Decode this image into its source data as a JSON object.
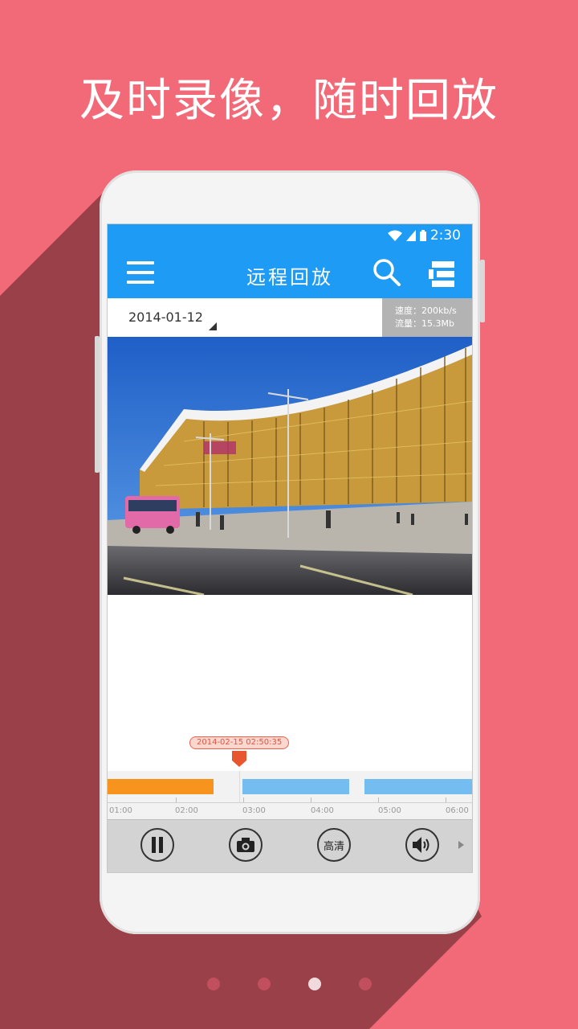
{
  "headline": "及时录像，随时回放",
  "status": {
    "time": "2:30"
  },
  "appbar": {
    "title": "远程回放"
  },
  "date_selector": {
    "value": "2014-01-12"
  },
  "stats": {
    "speed": "速度：200kb/s",
    "traffic": "流量：15.3Mb"
  },
  "timeline": {
    "current_time": "2014-02-15  02:50:35",
    "labels": [
      "01:00",
      "02:00",
      "03:00",
      "04:00",
      "05:00",
      "06:00"
    ]
  },
  "controls": {
    "hd_label": "高清"
  },
  "pager": {
    "count": 4,
    "active_index": 2
  },
  "colors": {
    "background": "#f26a78",
    "app_blue": "#1e9bf4",
    "recorded_alarm": "#f7941d",
    "recorded_normal": "#74bdf0",
    "marker": "#e8562f"
  },
  "icons": [
    "wifi-icon",
    "signal-icon",
    "battery-icon",
    "menu-icon",
    "search-icon",
    "list-icon",
    "pause-icon",
    "camera-icon",
    "speaker-icon",
    "chevron-right-icon"
  ]
}
